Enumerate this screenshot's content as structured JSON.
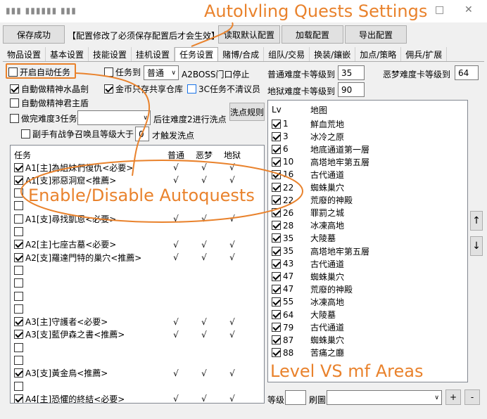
{
  "window": {
    "title": "▮▮▮ ▮▮▮▮▮▮ ▮▮▮",
    "maximize_symbol": "□",
    "close_symbol": "✕"
  },
  "toolbar": {
    "save_label": "保存成功",
    "notice": "【配置修改了必须保存配置后才会生效】",
    "read_default_label": "读取默认配置",
    "load_label": "加载配置",
    "export_label": "导出配置"
  },
  "tabs": [
    "物品设置",
    "基本设置",
    "技能设置",
    "挂机设置",
    "任务设置",
    "赌博/合成",
    "组队/交易",
    "换装/鑲嵌",
    "加点/策略",
    "佣兵/扩展"
  ],
  "options": {
    "auto_task_label": "开启自动任务",
    "task_to_label": "任务到",
    "task_difficulty": "普通",
    "a2boss_label": "A2BOSS门口停止",
    "normal_level_label": "普通难度卡等级到",
    "normal_level_value": "35",
    "nightmare_level_label": "恶梦难度卡等级到",
    "nightmare_level_value": "64",
    "hell_level_label": "地狱难度卡等级到",
    "hell_level_value": "90",
    "auto_crystal_label": "自動做精神水晶劍",
    "gold_stash_label": "金币只存共享仓库",
    "c3_label": "3C任务不清议员",
    "auto_king_label": "自動做精神君主盾",
    "finish_diff3_label": "做完难度3任务",
    "after_diff2_label": "后往难度2进行洗点",
    "wash_rules_label": "洗点规则",
    "helper_label": "副手有战争召唤且等级大于",
    "helper_value": "0",
    "trigger_label": "才触发洗点"
  },
  "quest_table": {
    "headers": [
      "任务",
      "普通",
      "恶梦",
      "地狱"
    ],
    "rows": [
      {
        "checked": true,
        "name": "A1[主]為姐妹們復仇<必要>",
        "n": "√",
        "m": "√",
        "h": "√"
      },
      {
        "checked": true,
        "name": "A1[支]邪惡洞窟<推薦>",
        "n": "√",
        "m": "√",
        "h": "√"
      },
      {
        "checked": false,
        "name": "",
        "n": "",
        "m": "",
        "h": ""
      },
      {
        "checked": false,
        "name": "",
        "n": "",
        "m": "",
        "h": ""
      },
      {
        "checked": false,
        "name": "A1[支]尋找凱恩<必要>",
        "n": "√",
        "m": "√",
        "h": "√"
      },
      {
        "checked": false,
        "name": "",
        "n": "",
        "m": "",
        "h": ""
      },
      {
        "checked": true,
        "name": "A2[主]七座古墓<必要>",
        "n": "√",
        "m": "√",
        "h": "√"
      },
      {
        "checked": true,
        "name": "A2[支]羅達門特的巢穴<推薦>",
        "n": "√",
        "m": "√",
        "h": "√"
      },
      {
        "checked": false,
        "name": "",
        "n": "",
        "m": "",
        "h": ""
      },
      {
        "checked": false,
        "name": "",
        "n": "",
        "m": "",
        "h": ""
      },
      {
        "checked": false,
        "name": "",
        "n": "",
        "m": "",
        "h": ""
      },
      {
        "checked": false,
        "name": "",
        "n": "",
        "m": "",
        "h": ""
      },
      {
        "checked": true,
        "name": "A3[主]守護者<必要>",
        "n": "√",
        "m": "√",
        "h": "√"
      },
      {
        "checked": true,
        "name": "A3[支]藍伊森之書<推薦>",
        "n": "√",
        "m": "√",
        "h": "√"
      },
      {
        "checked": false,
        "name": "",
        "n": "",
        "m": "",
        "h": ""
      },
      {
        "checked": false,
        "name": "",
        "n": "",
        "m": "",
        "h": ""
      },
      {
        "checked": true,
        "name": "A3[支]黃金鳥<推薦>",
        "n": "√",
        "m": "√",
        "h": "√"
      },
      {
        "checked": false,
        "name": "",
        "n": "",
        "m": "",
        "h": ""
      },
      {
        "checked": true,
        "name": "A4[主]恐懼的終結<必要>",
        "n": "√",
        "m": "√",
        "h": "√"
      }
    ]
  },
  "level_table": {
    "headers": [
      "Lv",
      "地图"
    ],
    "rows": [
      {
        "checked": true,
        "lv": "1",
        "area": "鮮血荒地"
      },
      {
        "checked": true,
        "lv": "3",
        "area": "冰冷之原"
      },
      {
        "checked": true,
        "lv": "6",
        "area": "地底通道第一層"
      },
      {
        "checked": true,
        "lv": "10",
        "area": "高塔地牢第五層"
      },
      {
        "checked": true,
        "lv": "16",
        "area": "古代通道"
      },
      {
        "checked": true,
        "lv": "22",
        "area": "蜘蛛巢穴"
      },
      {
        "checked": true,
        "lv": "22",
        "area": "荒廢的神殿"
      },
      {
        "checked": true,
        "lv": "26",
        "area": "罪罰之城"
      },
      {
        "checked": true,
        "lv": "28",
        "area": "冰凍高地"
      },
      {
        "checked": true,
        "lv": "35",
        "area": "大陵墓"
      },
      {
        "checked": true,
        "lv": "35",
        "area": "高塔地牢第五層"
      },
      {
        "checked": true,
        "lv": "43",
        "area": "古代通道"
      },
      {
        "checked": true,
        "lv": "47",
        "area": "蜘蛛巢穴"
      },
      {
        "checked": true,
        "lv": "47",
        "area": "荒廢的神殿"
      },
      {
        "checked": true,
        "lv": "55",
        "area": "冰凍高地"
      },
      {
        "checked": true,
        "lv": "64",
        "area": "大陵墓"
      },
      {
        "checked": true,
        "lv": "79",
        "area": "古代通道"
      },
      {
        "checked": true,
        "lv": "87",
        "area": "蜘蛛巢穴"
      },
      {
        "checked": true,
        "lv": "88",
        "area": "苦痛之廳"
      }
    ]
  },
  "bottom": {
    "level_label": "等级",
    "level_value": "",
    "map_label": "刷圖",
    "map_value": "",
    "plus_label": "+",
    "minus_label": "-"
  },
  "side_buttons": {
    "up": "↑",
    "down": "↓"
  },
  "annotations": {
    "title": "Autolvling Quests Settings",
    "enable": "Enable/Disable Autoquests",
    "level": "Level VS mf Areas",
    "color": "#e9822c"
  }
}
